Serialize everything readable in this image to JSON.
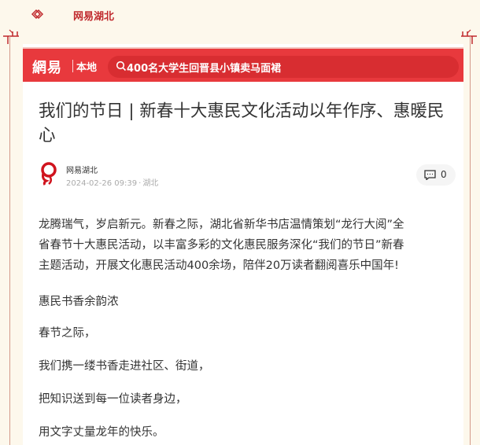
{
  "brand": {
    "name": "网易湖北",
    "diamond_icon": "double-diamond-icon",
    "color": "#c0292d"
  },
  "app_bar": {
    "logo_text": "網易",
    "local_label": "本地",
    "search_text": "400名大学生回晋县小镇卖马面裙",
    "search_icon": "search-icon",
    "bg_color": "#e8393d"
  },
  "article": {
    "title": "我们的节日 | 新春十大惠民文化活动以年作序、惠暖民心",
    "author": "网易湖北",
    "date": "2024-02-26 09:39",
    "location": "湖北",
    "comment_count": "0",
    "paragraphs": [
      [
        "龙腾瑞气，岁启新元。新春之际，湖北省新华书店温情策划“龙行大阅”全",
        "省春节十大惠民活动，以丰富多彩的文化惠民服务深化“我们的节日”新春",
        "主题活动，开展文化惠民活动400余场，陪伴20万读者翻阅喜乐中国年!"
      ],
      "惠民书香余韵浓",
      "春节之际，",
      "我们携一缕书香走进社区、街道，",
      "把知识送到每一位读者身边，",
      "用文字丈量龙年的快乐。"
    ]
  }
}
